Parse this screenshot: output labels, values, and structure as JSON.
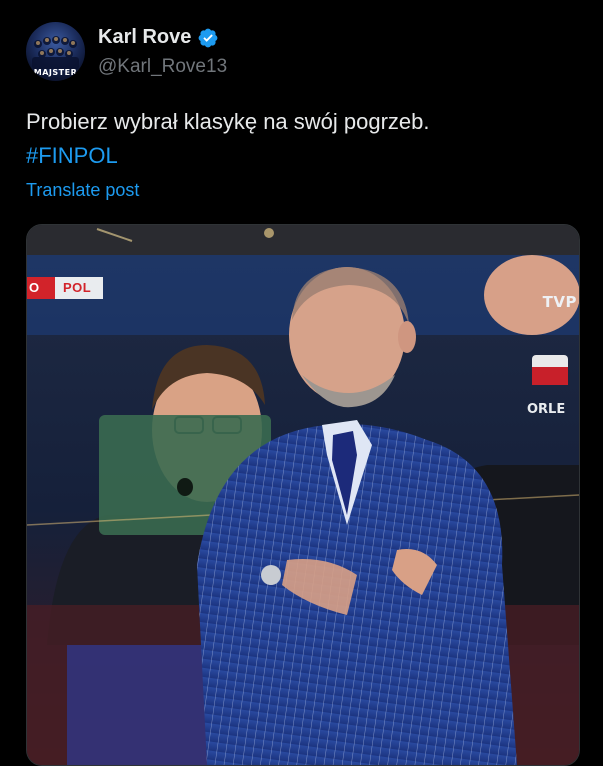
{
  "post": {
    "author": {
      "display_name": "Karl Rove",
      "handle": "@Karl_Rove13",
      "verified": true,
      "avatar_text": "MAJSTER"
    },
    "text": "Probierz wybrał klasykę na swój pogrzeb.",
    "hashtag": "#FINPOL",
    "translate_label": "Translate post"
  },
  "media": {
    "score_bug": {
      "left": "O",
      "team": "POL"
    },
    "broadcaster": "TVP"
  },
  "colors": {
    "background": "#000000",
    "text": "#e7e9ea",
    "secondary_text": "#71767b",
    "link": "#1d9bf0",
    "verified": "#1d9bf0"
  }
}
